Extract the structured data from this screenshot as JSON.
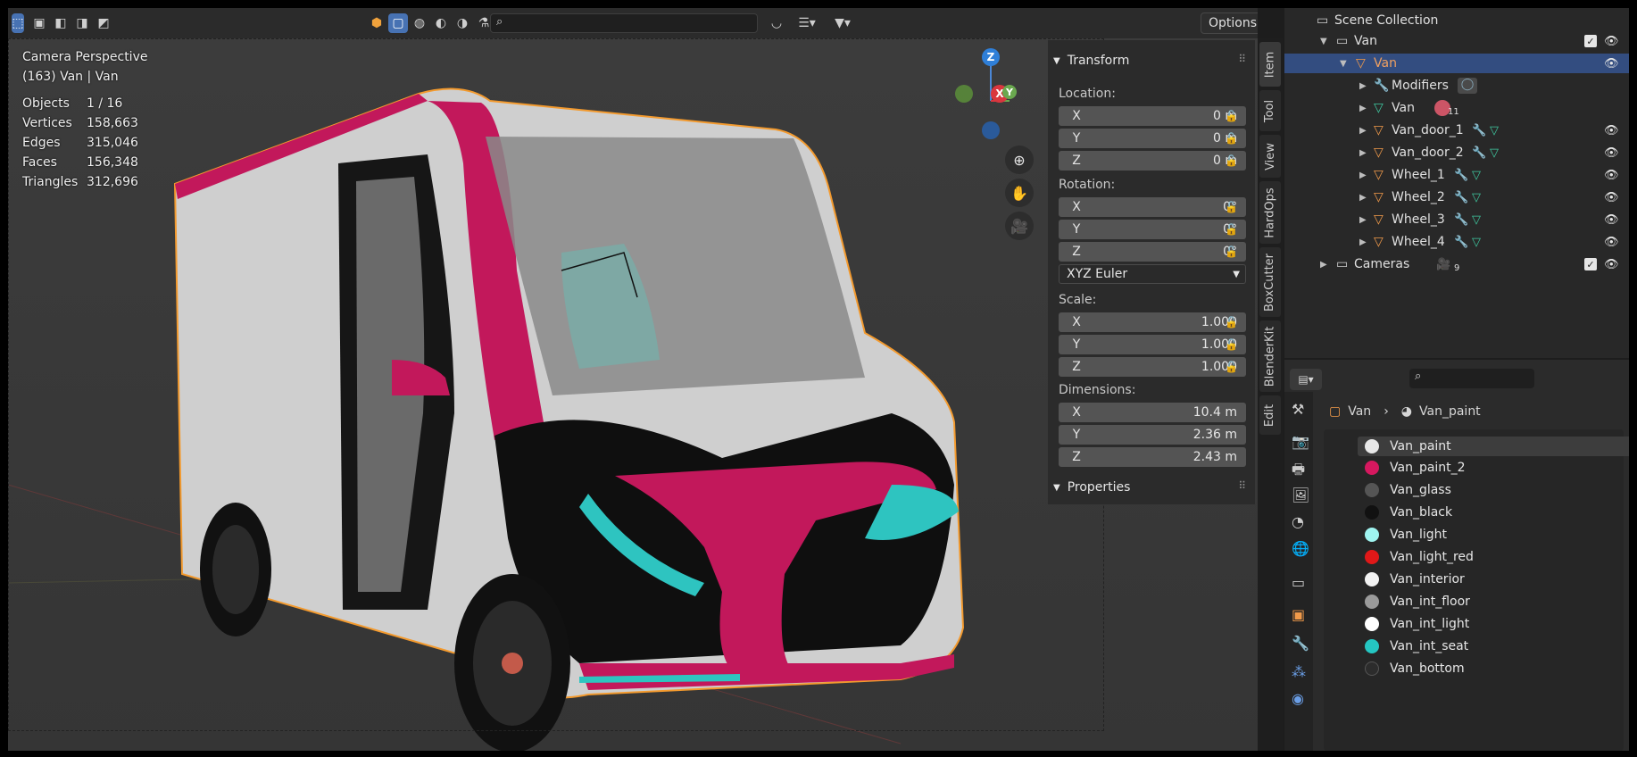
{
  "viewport": {
    "view_name": "Camera Perspective",
    "view_object": "(163) Van | Van",
    "stats": [
      {
        "label": "Objects",
        "value": "1 / 16"
      },
      {
        "label": "Vertices",
        "value": "158,663"
      },
      {
        "label": "Edges",
        "value": "315,046"
      },
      {
        "label": "Faces",
        "value": "156,348"
      },
      {
        "label": "Triangles",
        "value": "312,696"
      }
    ],
    "options_label": "Options",
    "gizmo": {
      "z": "Z",
      "x": "X",
      "y": "Y"
    }
  },
  "transform": {
    "title": "Transform",
    "location_label": "Location:",
    "location": [
      {
        "axis": "X",
        "value": "0 m"
      },
      {
        "axis": "Y",
        "value": "0 m"
      },
      {
        "axis": "Z",
        "value": "0 m"
      }
    ],
    "rotation_label": "Rotation:",
    "rotation": [
      {
        "axis": "X",
        "value": "0°"
      },
      {
        "axis": "Y",
        "value": "0°"
      },
      {
        "axis": "Z",
        "value": "0°"
      }
    ],
    "rotation_mode": "XYZ Euler",
    "scale_label": "Scale:",
    "scale": [
      {
        "axis": "X",
        "value": "1.000"
      },
      {
        "axis": "Y",
        "value": "1.000"
      },
      {
        "axis": "Z",
        "value": "1.000"
      }
    ],
    "dimensions_label": "Dimensions:",
    "dimensions": [
      {
        "axis": "X",
        "value": "10.4 m"
      },
      {
        "axis": "Y",
        "value": "2.36 m"
      },
      {
        "axis": "Z",
        "value": "2.43 m"
      }
    ],
    "properties_title": "Properties"
  },
  "side_tabs": [
    "Item",
    "Tool",
    "View",
    "HardOps",
    "BoxCutter",
    "BlenderKit",
    "Edit"
  ],
  "outliner": {
    "scene_collection": "Scene Collection",
    "collection": "Van",
    "object": "Van",
    "modifiers": "Modifiers",
    "mesh": "Van",
    "mesh_badge": "11",
    "children": [
      "Van_door_1",
      "Van_door_2",
      "Wheel_1",
      "Wheel_2",
      "Wheel_3",
      "Wheel_4"
    ],
    "cameras": "Cameras",
    "cameras_badge": "9"
  },
  "properties": {
    "breadcrumb_object": "Van",
    "breadcrumb_material": "Van_paint",
    "materials": [
      {
        "name": "Van_paint",
        "color": "#e8e8e8"
      },
      {
        "name": "Van_paint_2",
        "color": "#d6185f"
      },
      {
        "name": "Van_glass",
        "color": "#555555"
      },
      {
        "name": "Van_black",
        "color": "#111111"
      },
      {
        "name": "Van_light",
        "color": "#9ff4f0"
      },
      {
        "name": "Van_light_red",
        "color": "#e01818"
      },
      {
        "name": "Van_interior",
        "color": "#f2f2f2"
      },
      {
        "name": "Van_int_floor",
        "color": "#9a9a9a"
      },
      {
        "name": "Van_int_light",
        "color": "#ffffff"
      },
      {
        "name": "Van_int_seat",
        "color": "#25c6c2"
      },
      {
        "name": "Van_bottom",
        "color": "#2c2c2c"
      }
    ]
  },
  "colors": {
    "accent": "#4772b3",
    "paint": "#c2185b",
    "teal": "#2ec4c0",
    "selection": "#f39a2e"
  }
}
